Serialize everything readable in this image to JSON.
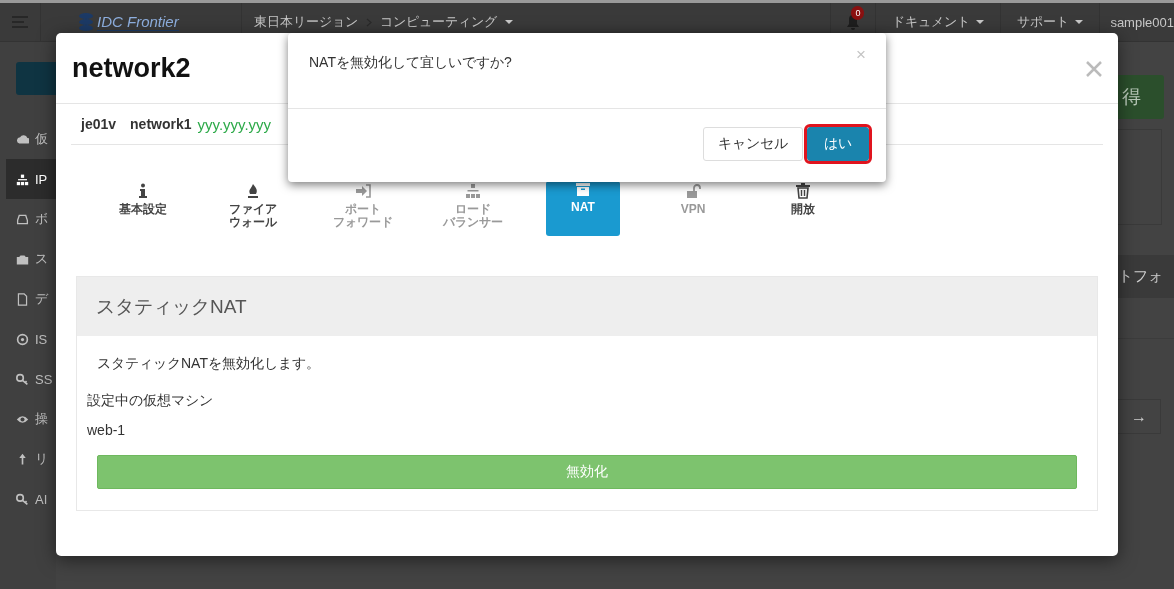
{
  "header": {
    "logo": "IDC Frontier",
    "breadcrumb": [
      "東日本リージョン",
      "コンピューティング"
    ],
    "notifications": "0",
    "menus": [
      "ドキュメント",
      "サポート",
      "sample001"
    ]
  },
  "sidebar": {
    "items": [
      {
        "label": "仮",
        "selected": false
      },
      {
        "label": "IP",
        "selected": true
      },
      {
        "label": "ボ",
        "selected": false
      },
      {
        "label": "ス",
        "selected": false
      },
      {
        "label": "デ",
        "selected": false
      },
      {
        "label": "IS",
        "selected": false
      },
      {
        "label": "SS",
        "selected": false
      },
      {
        "label": "操",
        "selected": false
      },
      {
        "label": "リ",
        "selected": false
      },
      {
        "label": "AI",
        "selected": false
      }
    ]
  },
  "background_content": {
    "button": "得",
    "section": "トフォ",
    "arrow": "→"
  },
  "modal": {
    "title": "network2",
    "zone": "je01v",
    "network": "network1",
    "address": "yyy.yyy.yyy",
    "tabs": [
      {
        "lines": [
          "基本設定"
        ],
        "selected": false,
        "disabled": false
      },
      {
        "lines": [
          "ファイア",
          "ウォール"
        ],
        "selected": false,
        "disabled": false
      },
      {
        "lines": [
          "ポート",
          "フォワード"
        ],
        "selected": false,
        "disabled": true
      },
      {
        "lines": [
          "ロード",
          "バランサー"
        ],
        "selected": false,
        "disabled": true
      },
      {
        "lines": [
          "NAT"
        ],
        "selected": true,
        "disabled": false
      },
      {
        "lines": [
          "VPN"
        ],
        "selected": false,
        "disabled": true
      },
      {
        "lines": [
          "開放"
        ],
        "selected": false,
        "disabled": false
      }
    ],
    "panel": {
      "title": "スタティックNAT",
      "description": "スタティックNATを無効化します。",
      "vm_label": "設定中の仮想マシン",
      "vm": "web-1",
      "button": "無効化"
    }
  },
  "confirm_dialog": {
    "message": "NATを無効化して宜しいですか?",
    "close": "×",
    "buttons": [
      {
        "label": "キャンセル",
        "kind": "default",
        "highlighted": false
      },
      {
        "label": "はい",
        "kind": "primary",
        "highlighted": true
      }
    ]
  }
}
